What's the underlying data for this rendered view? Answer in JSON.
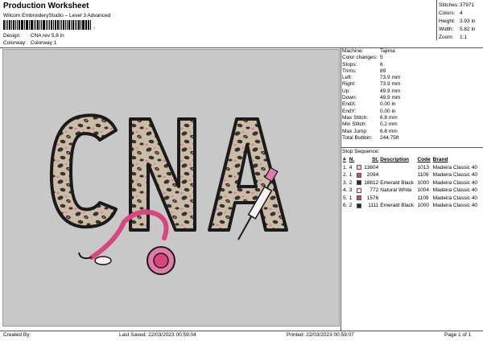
{
  "header": {
    "title": "Production Worksheet",
    "subtitle": "Wilcom EmbroideryStudio – Level 3 Advanced",
    "barcode_mark": ",",
    "design_label": "Design:",
    "design_value": "CNA rev 5,8 in",
    "colorway_label": "Colorway:",
    "colorway_value": "Colorway 1"
  },
  "stats": [
    {
      "label": "Stitches:",
      "value": "37971"
    },
    {
      "label": "Colors:",
      "value": "4"
    },
    {
      "label": "Height:",
      "value": "3.93 in"
    },
    {
      "label": "Width:",
      "value": "5.82 in"
    },
    {
      "label": "Zoom:",
      "value": "1:1"
    }
  ],
  "machine_info": [
    {
      "label": "Machine:",
      "value": "Tajima"
    },
    {
      "label": "Color changes:",
      "value": "5"
    },
    {
      "label": "Stops:",
      "value": "6"
    },
    {
      "label": "Trims:",
      "value": "89"
    },
    {
      "label": "Left:",
      "value": "73.9 mm"
    },
    {
      "label": "Right:",
      "value": "73.9 mm"
    },
    {
      "label": "Up:",
      "value": "49.9 mm"
    },
    {
      "label": "Down:",
      "value": "49.9 mm"
    },
    {
      "label": "EndX:",
      "value": "0.00 in"
    },
    {
      "label": "EndY:",
      "value": "0.00 in"
    },
    {
      "label": "Max Stitch:",
      "value": "6.8 mm"
    },
    {
      "label": "Min Stitch:",
      "value": "0.2 mm"
    },
    {
      "label": "Max Jump:",
      "value": "6.8 mm"
    },
    {
      "label": "Total Bobbin:",
      "value": "244.75ft"
    }
  ],
  "stop_sequence": {
    "title": "Stop Sequence:",
    "headers": [
      "#",
      "N.",
      "St.",
      "Description",
      "Code",
      "Brand"
    ],
    "rows": [
      {
        "num": "1.",
        "n": "4",
        "color": "#f2c9d6",
        "st": "13604",
        "desc": "",
        "code": "1013",
        "brand": "Madeira Classic 40"
      },
      {
        "num": "2.",
        "n": "1",
        "color": "#d9457f",
        "st": "2094",
        "desc": "",
        "code": "1109",
        "brand": "Madeira Classic 40"
      },
      {
        "num": "3.",
        "n": "2",
        "color": "#2a2a2a",
        "st": "18812",
        "desc": "Emerald Black",
        "code": "1000",
        "brand": "Madeira Classic 40"
      },
      {
        "num": "4.",
        "n": "3",
        "color": "#ece6d6",
        "st": "772",
        "desc": "Natural White",
        "code": "1004",
        "brand": "Madeira Classic 40"
      },
      {
        "num": "5.",
        "n": "1",
        "color": "#d9457f",
        "st": "1576",
        "desc": "",
        "code": "1109",
        "brand": "Madeira Classic 40"
      },
      {
        "num": "6.",
        "n": "2",
        "color": "#2a2a2a",
        "st": "1111",
        "desc": "Emerald Black",
        "code": "1000",
        "brand": "Madeira Classic 40"
      }
    ]
  },
  "design_preview": {
    "text": "CNA",
    "letter_fill": "#c9bba5",
    "spot_color": "#2f2f2f",
    "accent_color": "#e07aa6",
    "outline_color": "#1a1a1a"
  },
  "footer": {
    "created_by": "Created By:",
    "last_saved": "Last Saved: 22/03/2023 00:59:04",
    "printed": "Printed: 22/03/2023 00:59:07",
    "page": "Page 1 of 1"
  }
}
